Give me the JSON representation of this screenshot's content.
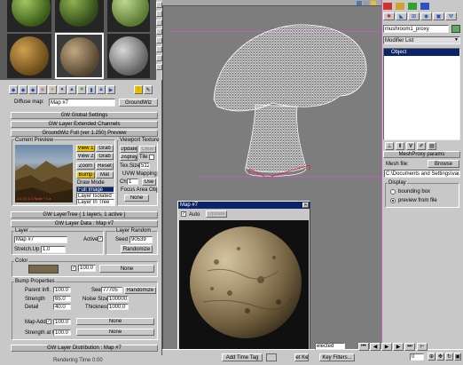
{
  "viewport": {
    "colors": {
      "bg": "#7d7d7d",
      "mesh": "#ffffff",
      "selection": "#c05ec0",
      "bbox": "#e0203f"
    }
  },
  "material_editor": {
    "diffuse_label": "Diffuse map:",
    "map_name": "Map #7",
    "map_type": "GroundWiz",
    "rollouts": {
      "global_settings": "GW Global Settings",
      "extended_channels": "GW Layer Extended Channels",
      "preview_header": "GroundWiz Full (ver 1.250) Preview",
      "layer_tree": "GW LayerTree  ( 1 layers, 1 active )",
      "layer_data": "GW Layer Data : Map #7",
      "layer_distribution": "GW Layer Distribution : Map #7"
    },
    "preview": {
      "current_preview_label": "Current Preview",
      "view1": "View 1",
      "view2": "View 2",
      "grab1": "Grab",
      "grab2": "Grab",
      "zoom": "Zoom",
      "reset": "Reset",
      "bump": "Bump",
      "mat": "Mat",
      "draw_mode_label": "Draw Mode",
      "draw_modes": [
        "Full Image",
        "Layer Isolated",
        "Layer In Tree"
      ],
      "overlay_text": "1:1 (1) 1:1 Node  * 3 a"
    },
    "viewport_texture": {
      "label": "Viewport Texture",
      "update": "Update",
      "clear": "Clear",
      "display": "Display",
      "tile": "Tile",
      "tex_size_label": "Tex.Size",
      "tex_size": "512"
    },
    "uvw_mapping": {
      "label": "UVW Mapping",
      "ch_label": "Ch",
      "ch_value": "1",
      "use": "Use"
    },
    "focus_area": {
      "label": "Focus Area Obj",
      "value": "None"
    },
    "layer": {
      "group_label": "Layer",
      "name": "Map #7",
      "active_label": "Active",
      "stretch_label": "Stretch.Up",
      "stretch_value": "1.0"
    },
    "layer_random": {
      "label": "Layer Random",
      "seed_label": "Seed",
      "seed_value": "90539",
      "randomize": "Randomize"
    },
    "color": {
      "label": "Color",
      "swatch": "#786848",
      "amount": "100.0",
      "map": "None"
    },
    "bump_properties": {
      "label": "Bump Properties",
      "parent_infl_label": "Parent Infl.",
      "parent_infl": "100.0",
      "strength_label": "Strength",
      "strength": "65.0",
      "detail_label": "Detail",
      "detail": "40.0",
      "seed_label": "Seed",
      "seed": "77705",
      "randomize": "Randomize",
      "noise_size_label": "Noise Size",
      "noise_size": "100000.0",
      "thickness_label": "Thickness",
      "thickness": "1000.0",
      "map_add_label": "Map Add",
      "map_add": "100.0",
      "map_add_none": "None",
      "strength_at_label": "Strength at 0",
      "strength_at": "100.0",
      "strength_at_none": "None"
    }
  },
  "render_dialog": {
    "title": "Map #7",
    "auto": "Auto",
    "update": "Update"
  },
  "command_panel": {
    "object_name": "mushroom1_proxy",
    "modifier_list": "Modifier List",
    "stack_item": "Object",
    "meshproxy_rollout": "MeshProxy params",
    "mesh_file_label": "Mesh file:",
    "browse": "Browse",
    "mesh_path": "C:\\Documents and Settings\\vau",
    "display_label": "Display",
    "display_options": [
      "bounding box",
      "preview from file"
    ],
    "display_selected": 1
  },
  "status_bar": {
    "left_text": "Rendering Time 0:00",
    "selected_text": "elected",
    "set_key": "Set Key",
    "key_filters": "Key Filters...",
    "add_time_tag": "Add Time Tag",
    "frame_value": "0"
  }
}
